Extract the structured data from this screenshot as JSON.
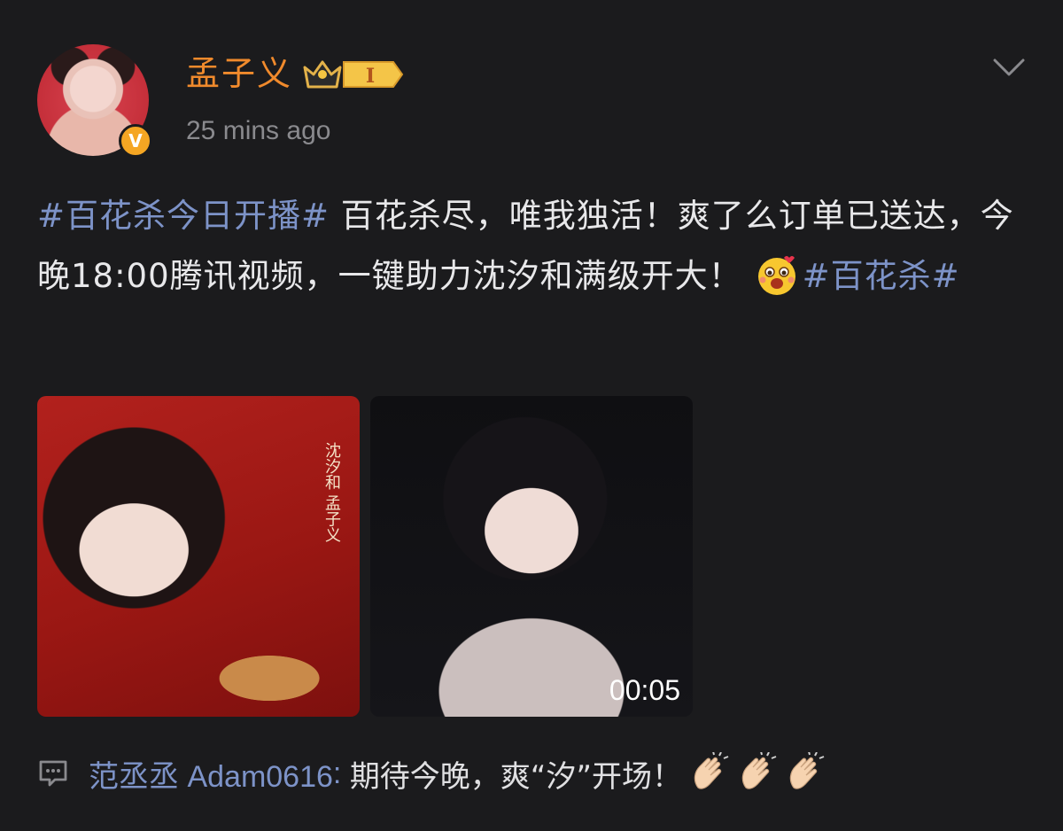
{
  "post": {
    "author": {
      "name": "孟子义",
      "verified_badge": "V",
      "member_badge_level": "I"
    },
    "timestamp": "25 mins ago",
    "content": {
      "hashtag_1": "#百花杀今日开播#",
      "text_1": " 百花杀尽，唯我独活！爽了么订单已送达，今晚18:00腾讯视频，一键助力沈汐和满级开大！",
      "emoji": "excited-face-emoji",
      "hashtag_2": "#百花杀#"
    },
    "media": [
      {
        "type": "image",
        "caption": "沈汐和 孟子义"
      },
      {
        "type": "video",
        "duration": "00:05"
      }
    ],
    "comment": {
      "author": "范丞丞 Adam0616",
      "separator": ": ",
      "text": "期待今晚，爽“汐”开场！",
      "emoji": "clapping-hands-emoji"
    }
  },
  "colors": {
    "background": "#1b1b1d",
    "username": "#f08a2c",
    "link": "#7d93c8",
    "text": "#e8e8ea",
    "muted": "#8a8a8e"
  }
}
